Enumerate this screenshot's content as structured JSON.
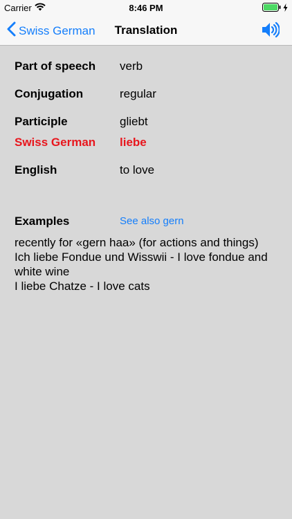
{
  "statusbar": {
    "carrier": "Carrier",
    "time": "8:46 PM"
  },
  "nav": {
    "back_label": "Swiss German",
    "title": "Translation",
    "accent_color": "#147efb"
  },
  "rows": {
    "pos_label": "Part of speech",
    "pos_value": "verb",
    "conj_label": "Conjugation",
    "conj_value": "regular",
    "participle_label": "Participle",
    "participle_value": "gliebt",
    "swiss_label": "Swiss German",
    "swiss_value": "liebe",
    "english_label": "English",
    "english_value": "to love"
  },
  "examples": {
    "label": "Examples",
    "see_also": "See also gern",
    "lines": [
      "recently for «gern haa» (for actions and things)",
      "Ich liebe Fondue und Wisswii - I love fondue and white wine",
      "I liebe Chatze - I love cats"
    ]
  },
  "highlight_color": "#e8161d"
}
